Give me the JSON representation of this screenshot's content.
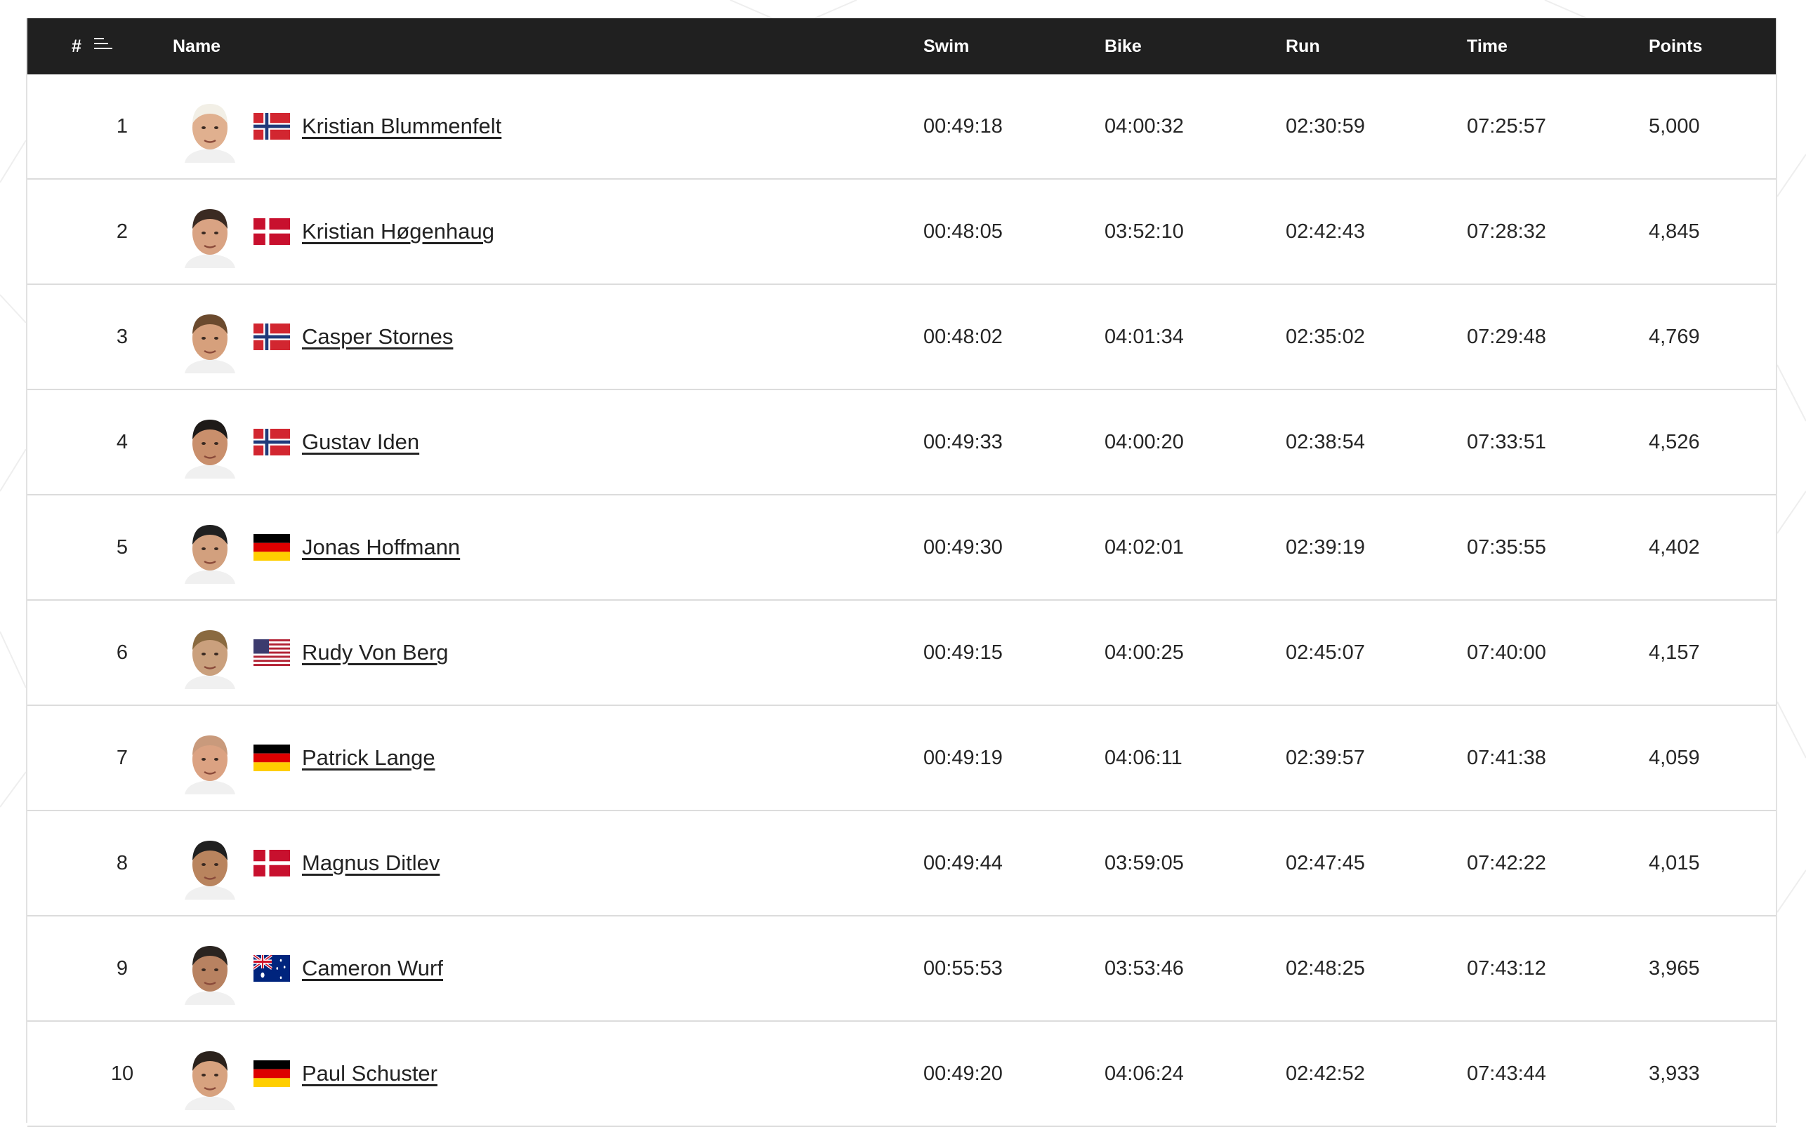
{
  "table": {
    "headers": {
      "rank": "#",
      "name": "Name",
      "swim": "Swim",
      "bike": "Bike",
      "run": "Run",
      "time": "Time",
      "points": "Points"
    },
    "rows": [
      {
        "rank": "1",
        "name": "Kristian Blummenfelt",
        "flag": "norway-flag-icon",
        "swim": "00:49:18",
        "bike": "04:00:32",
        "run": "02:30:59",
        "time": "07:25:57",
        "points": "5,000"
      },
      {
        "rank": "2",
        "name": "Kristian Høgenhaug",
        "flag": "denmark-flag-icon",
        "swim": "00:48:05",
        "bike": "03:52:10",
        "run": "02:42:43",
        "time": "07:28:32",
        "points": "4,845"
      },
      {
        "rank": "3",
        "name": "Casper Stornes",
        "flag": "norway-flag-icon",
        "swim": "00:48:02",
        "bike": "04:01:34",
        "run": "02:35:02",
        "time": "07:29:48",
        "points": "4,769"
      },
      {
        "rank": "4",
        "name": "Gustav Iden",
        "flag": "norway-flag-icon",
        "swim": "00:49:33",
        "bike": "04:00:20",
        "run": "02:38:54",
        "time": "07:33:51",
        "points": "4,526"
      },
      {
        "rank": "5",
        "name": "Jonas Hoffmann",
        "flag": "germany-flag-icon",
        "swim": "00:49:30",
        "bike": "04:02:01",
        "run": "02:39:19",
        "time": "07:35:55",
        "points": "4,402"
      },
      {
        "rank": "6",
        "name": "Rudy Von Berg",
        "flag": "usa-flag-icon",
        "swim": "00:49:15",
        "bike": "04:00:25",
        "run": "02:45:07",
        "time": "07:40:00",
        "points": "4,157"
      },
      {
        "rank": "7",
        "name": "Patrick Lange",
        "flag": "germany-flag-icon",
        "swim": "00:49:19",
        "bike": "04:06:11",
        "run": "02:39:57",
        "time": "07:41:38",
        "points": "4,059"
      },
      {
        "rank": "8",
        "name": "Magnus Ditlev",
        "flag": "denmark-flag-icon",
        "swim": "00:49:44",
        "bike": "03:59:05",
        "run": "02:47:45",
        "time": "07:42:22",
        "points": "4,015"
      },
      {
        "rank": "9",
        "name": "Cameron Wurf",
        "flag": "australia-flag-icon",
        "swim": "00:55:53",
        "bike": "03:53:46",
        "run": "02:48:25",
        "time": "07:43:12",
        "points": "3,965"
      },
      {
        "rank": "10",
        "name": "Paul Schuster",
        "flag": "germany-flag-icon",
        "swim": "00:49:20",
        "bike": "04:06:24",
        "run": "02:42:52",
        "time": "07:43:44",
        "points": "3,933"
      }
    ]
  }
}
